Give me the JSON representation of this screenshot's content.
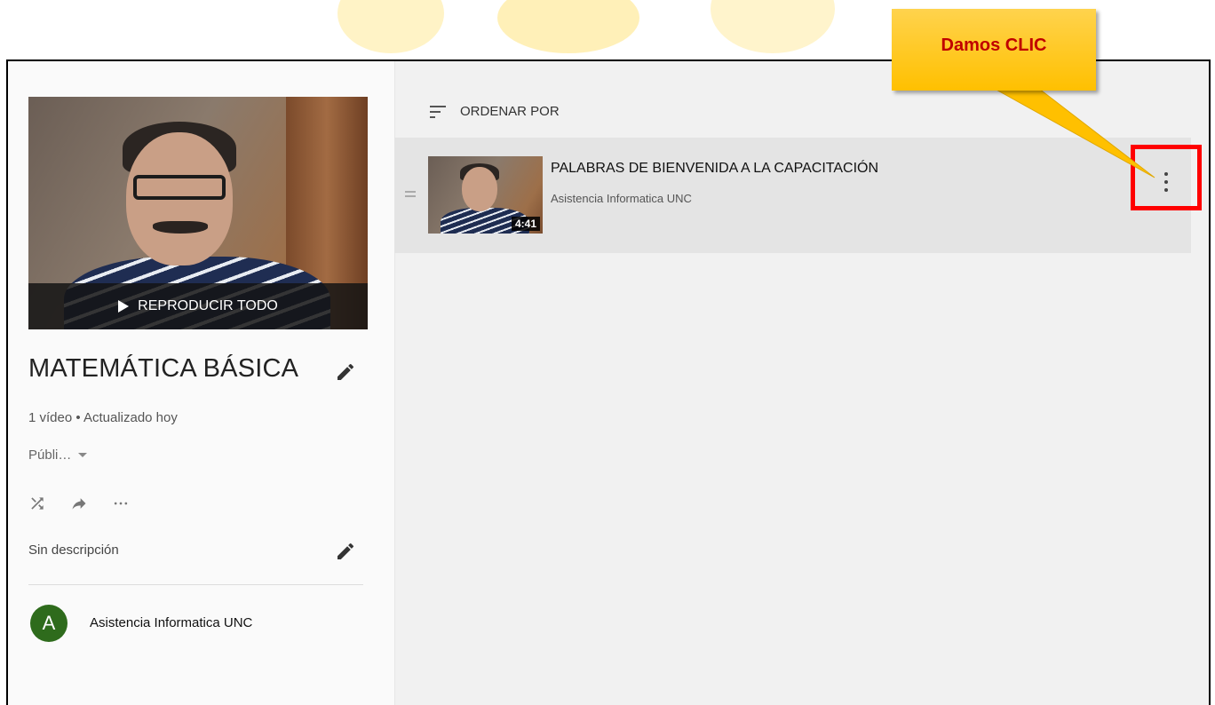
{
  "playlist": {
    "play_all_label": "REPRODUCIR TODO",
    "title": "MATEMÁTICA BÁSICA",
    "meta": "1 vídeo • Actualizado hoy",
    "privacy": "Públi…",
    "description": "Sin descripción",
    "owner_initial": "A",
    "owner_name": "Asistencia Informatica UNC"
  },
  "list": {
    "sort_label": "ORDENAR POR",
    "items": [
      {
        "title": "PALABRAS DE BIENVENIDA A LA CAPACITACIÓN",
        "channel": "Asistencia Informatica UNC",
        "duration": "4:41"
      }
    ]
  },
  "annotation": {
    "callout_text": "Damos CLIC"
  },
  "colors": {
    "highlight": "#ff0000",
    "callout_fill": "#ffc000",
    "callout_text": "#c00000",
    "avatar": "#2e6b1c"
  }
}
